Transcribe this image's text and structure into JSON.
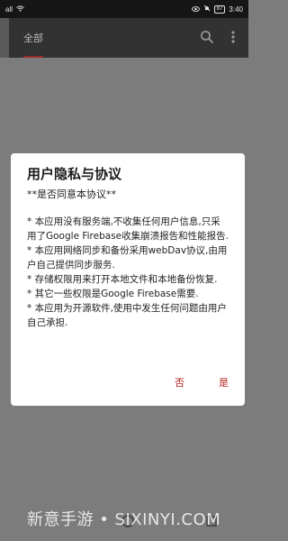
{
  "status_bar": {
    "signal": "all",
    "battery": "87",
    "time": "3:40"
  },
  "app_bar": {
    "tab_label": "全部",
    "search_icon": "search-icon",
    "more_icon": "more-vert-icon"
  },
  "dialog": {
    "title": "用户隐私与协议",
    "subtitle": "**是否同意本协议**",
    "items": [
      "* 本应用没有服务端,不收集任何用户信息,只采用了Google Firebase收集崩溃报告和性能报告.",
      "* 本应用网络同步和备份采用webDav协议,由用户自己提供同步服务.",
      "* 存储权限用来打开本地文件和本地备份恢复.",
      "* 其它一些权限是Google Firebase需要.",
      "* 本应用为开源软件,使用中发生任何问题由用户自己承担."
    ],
    "negative_label": "否",
    "positive_label": "是",
    "accent_color": "#b2231c"
  },
  "watermark": "新意手游 • SIXINYI.COM"
}
